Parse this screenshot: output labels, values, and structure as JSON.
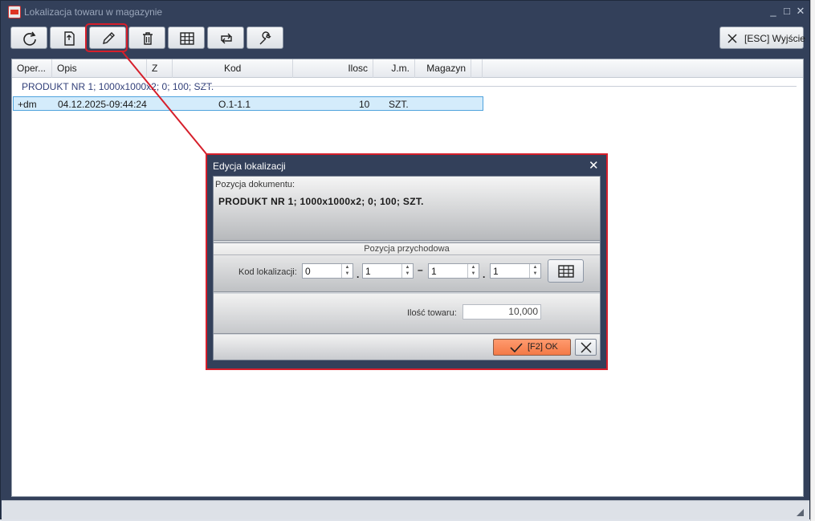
{
  "window": {
    "title": "Lokalizacja towaru w magazynie",
    "minimize": "_",
    "maximize": "□",
    "close": "✕"
  },
  "toolbar": {
    "buttons": [
      {
        "name": "refresh-icon"
      },
      {
        "name": "new-document-icon"
      },
      {
        "name": "edit-pencil-icon"
      },
      {
        "name": "trash-icon"
      },
      {
        "name": "grid-icon"
      },
      {
        "name": "repeat-icon"
      },
      {
        "name": "wrench-icon"
      }
    ],
    "exit_label": "[ESC] Wyjście"
  },
  "grid": {
    "columns": [
      "Oper...",
      "Opis",
      "Z",
      "Kod",
      "Ilosc",
      "J.m.",
      "Magazyn"
    ],
    "group_label": "PRODUKT NR 1; 1000x1000x2; 0; 100; SZT.",
    "rows": [
      {
        "oper": "+dm",
        "opis": "04.12.2025-09:44:24",
        "kod": "O.1-1.1",
        "ilosc": "10",
        "jm": "SZT."
      }
    ]
  },
  "dialog": {
    "title": "Edycja lokalizacji",
    "close": "✕",
    "doc_position_label": "Pozycja dokumentu:",
    "product": "PRODUKT NR 1; 1000x1000x2; 0; 100; SZT.",
    "section_title": "Pozycja przychodowa",
    "kod_label": "Kod lokalizacji:",
    "kod_parts": [
      "0",
      "1",
      "1",
      "1"
    ],
    "sep1": ".",
    "sep2": "–",
    "sep3": ".",
    "qty_label": "Ilość towaru:",
    "qty_value": "10,000",
    "ok_label": "[F2] OK"
  },
  "colors": {
    "frame": "#33405a",
    "highlight": "#d61f2b",
    "ok_button": "#f47a47",
    "selected_row": "#d4ecfb"
  }
}
